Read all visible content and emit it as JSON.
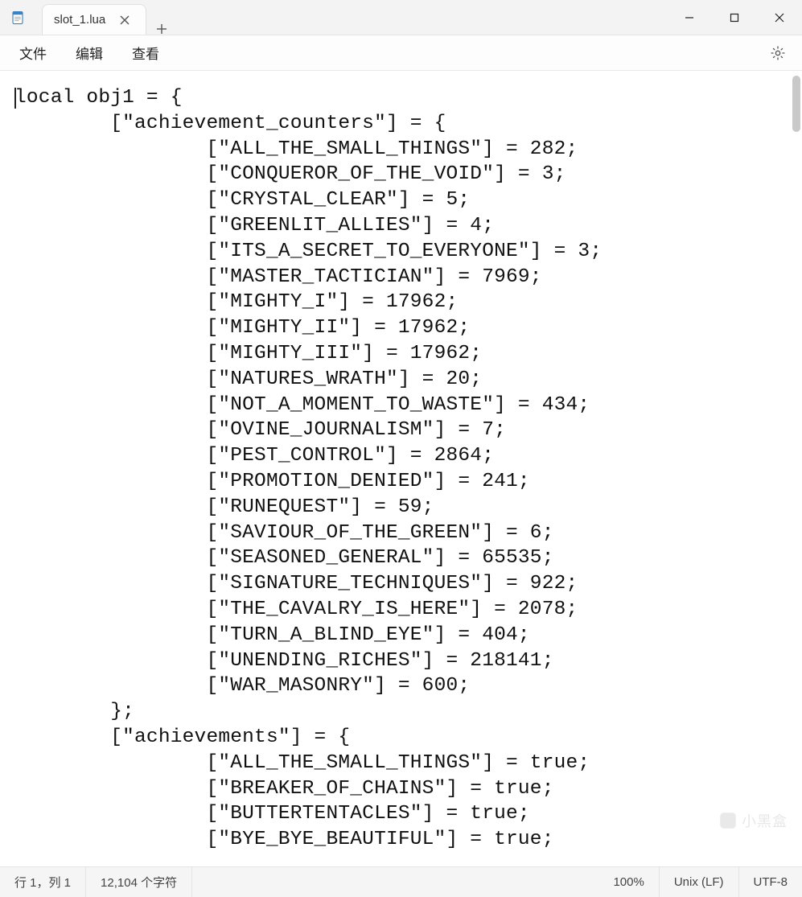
{
  "titlebar": {
    "tab_label": "slot_1.lua"
  },
  "menubar": {
    "file": "文件",
    "edit": "编辑",
    "view": "查看"
  },
  "code": {
    "decl": "local obj1 = {",
    "key_counters": "[\"achievement_counters\"] = {",
    "counters": [
      {
        "k": "ALL_THE_SMALL_THINGS",
        "v": "282"
      },
      {
        "k": "CONQUEROR_OF_THE_VOID",
        "v": "3"
      },
      {
        "k": "CRYSTAL_CLEAR",
        "v": "5"
      },
      {
        "k": "GREENLIT_ALLIES",
        "v": "4"
      },
      {
        "k": "ITS_A_SECRET_TO_EVERYONE",
        "v": "3"
      },
      {
        "k": "MASTER_TACTICIAN",
        "v": "7969"
      },
      {
        "k": "MIGHTY_I",
        "v": "17962"
      },
      {
        "k": "MIGHTY_II",
        "v": "17962"
      },
      {
        "k": "MIGHTY_III",
        "v": "17962"
      },
      {
        "k": "NATURES_WRATH",
        "v": "20"
      },
      {
        "k": "NOT_A_MOMENT_TO_WASTE",
        "v": "434"
      },
      {
        "k": "OVINE_JOURNALISM",
        "v": "7"
      },
      {
        "k": "PEST_CONTROL",
        "v": "2864"
      },
      {
        "k": "PROMOTION_DENIED",
        "v": "241"
      },
      {
        "k": "RUNEQUEST",
        "v": "59"
      },
      {
        "k": "SAVIOUR_OF_THE_GREEN",
        "v": "6"
      },
      {
        "k": "SEASONED_GENERAL",
        "v": "65535"
      },
      {
        "k": "SIGNATURE_TECHNIQUES",
        "v": "922"
      },
      {
        "k": "THE_CAVALRY_IS_HERE",
        "v": "2078"
      },
      {
        "k": "TURN_A_BLIND_EYE",
        "v": "404"
      },
      {
        "k": "UNENDING_RICHES",
        "v": "218141"
      },
      {
        "k": "WAR_MASONRY",
        "v": "600"
      }
    ],
    "close_block": "};",
    "key_achievements": "[\"achievements\"] = {",
    "achievements": [
      {
        "k": "ALL_THE_SMALL_THINGS",
        "v": "true"
      },
      {
        "k": "BREAKER_OF_CHAINS",
        "v": "true"
      },
      {
        "k": "BUTTERTENTACLES",
        "v": "true"
      },
      {
        "k": "BYE_BYE_BEAUTIFUL",
        "v": "true"
      }
    ]
  },
  "statusbar": {
    "pos": "行 1，列 1",
    "chars": "12,104 个字符",
    "zoom": "100%",
    "eol": "Unix (LF)",
    "encoding": "UTF-8"
  },
  "watermark": "小黑盒"
}
